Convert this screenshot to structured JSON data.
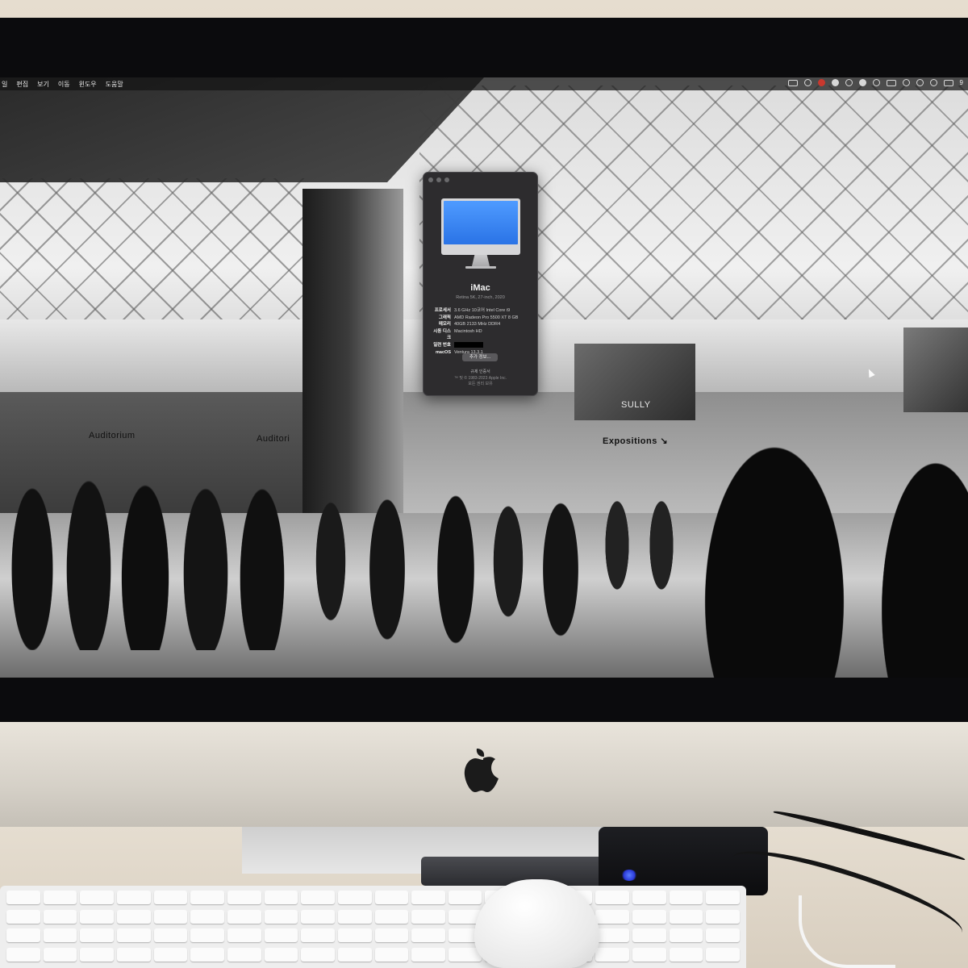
{
  "menubar": {
    "items": [
      "일",
      "편집",
      "보기",
      "이동",
      "윈도우",
      "도움말"
    ],
    "status_icons": [
      "record-icon",
      "circle-icon",
      "cc-icon",
      "a-icon",
      "nav-icon",
      "sound-icon",
      "display-icon",
      "battery-icon",
      "bluetooth-icon",
      "wifi-icon",
      "search-icon",
      "control-center-icon"
    ],
    "clock_fragment": "9"
  },
  "about_window": {
    "title": "iMac",
    "subtitle": "Retina 5K, 27-inch, 2020",
    "specs": [
      {
        "key": "프로세서",
        "value": "3.6 GHz 10코어 Intel Core i9"
      },
      {
        "key": "그래픽",
        "value": "AMD Radeon Pro 5500 XT 8 GB"
      },
      {
        "key": "메모리",
        "value": "40GB 2133 MHz DDR4"
      },
      {
        "key": "시동 디스크",
        "value": "Macintosh HD"
      },
      {
        "key": "일련 번호",
        "value": ""
      },
      {
        "key": "macOS",
        "value": "Ventura 13.3.1"
      }
    ],
    "more_info_button": "추가 정보...",
    "regulatory_link": "규제 인증서",
    "copyright_line1": "™ 및 © 1983-2023 Apple Inc.",
    "copyright_line2": "모든 권리 보유"
  },
  "wallpaper": {
    "labels": {
      "auditorium_left": "Auditorium",
      "auditorium_right": "Auditori",
      "sully": "SULLY",
      "expositions": "Expositions ↘"
    }
  },
  "colors": {
    "window_bg": "#2d2c2e",
    "screen_blue": "#4f9bff",
    "led_blue": "#2b3ad8"
  }
}
